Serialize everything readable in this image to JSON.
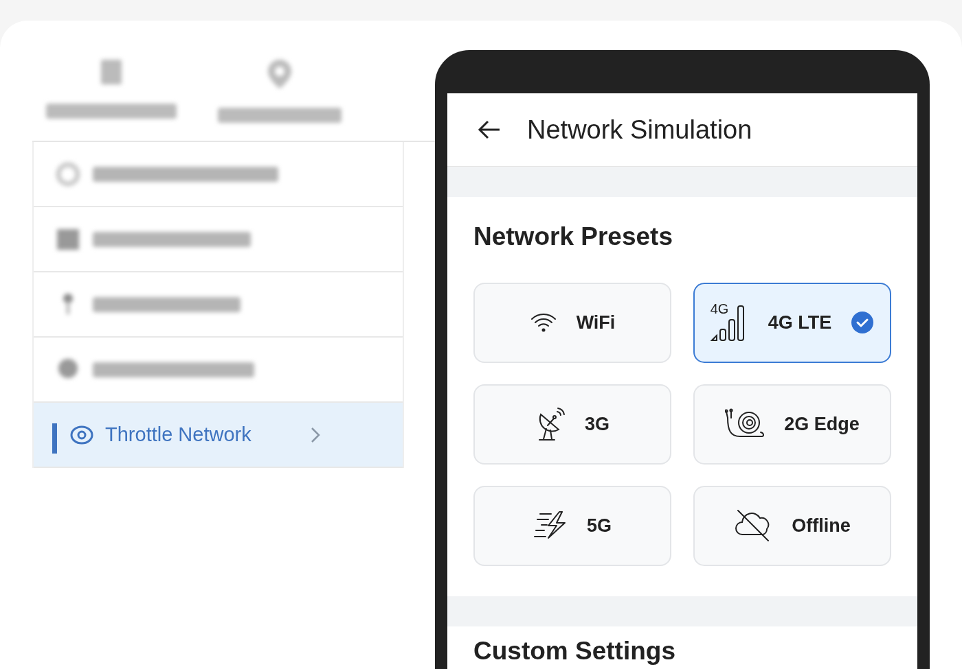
{
  "toolbar": [
    {
      "kind": "device"
    },
    {
      "kind": "pin"
    }
  ],
  "menu": [
    {
      "kind": "ring",
      "selected": false
    },
    {
      "kind": "square",
      "selected": false
    },
    {
      "kind": "pin",
      "selected": false
    },
    {
      "kind": "dot",
      "selected": false
    },
    {
      "kind": "eye",
      "label": "Throttle Network",
      "selected": true
    }
  ],
  "phone": {
    "title": "Network Simulation",
    "section": "Network Presets",
    "presets": [
      {
        "label": "WiFi",
        "kind": "wifi",
        "selected": false
      },
      {
        "label": "4G LTE",
        "kind": "signal",
        "icon_text": "4G",
        "selected": true
      },
      {
        "label": "3G",
        "kind": "dish",
        "selected": false
      },
      {
        "label": "2G Edge",
        "kind": "snail",
        "selected": false
      },
      {
        "label": "5G",
        "kind": "bolt",
        "selected": false
      },
      {
        "label": "Offline",
        "kind": "cloud-off",
        "selected": false
      }
    ],
    "section_2": "Custom Settings"
  }
}
